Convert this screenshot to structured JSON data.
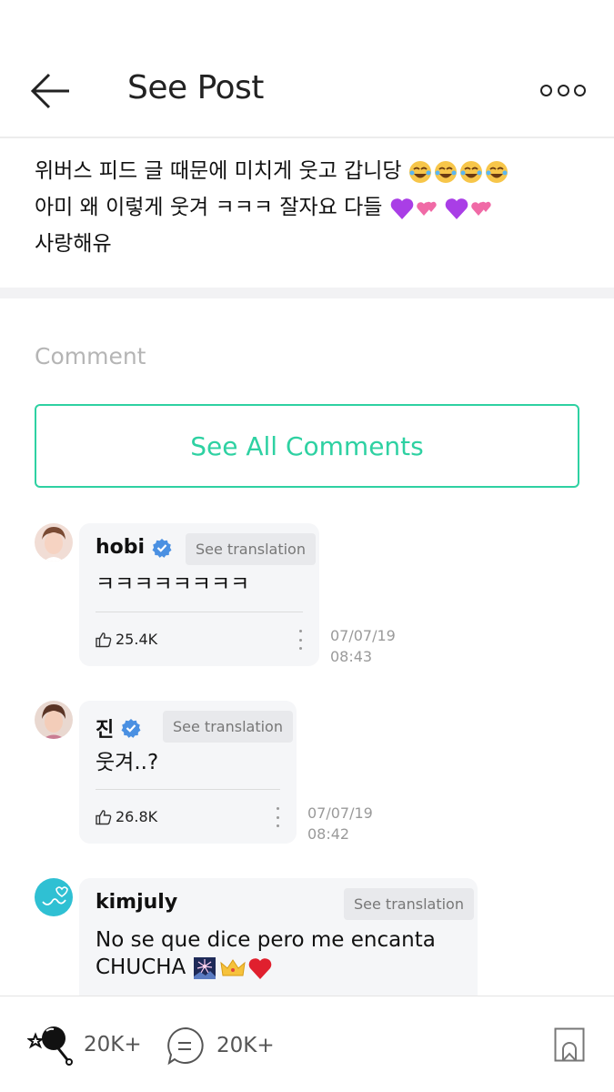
{
  "header": {
    "title": "See Post"
  },
  "post": {
    "line1": "위버스 피드 글 때문에 미치게 웃고 갑니당",
    "line2": "아미 왜 이렇게 웃겨 ㅋㅋㅋ 잘자요 다들",
    "line3": "사랑해유"
  },
  "comments_section": {
    "label": "Comment",
    "see_all_label": "See All Comments"
  },
  "comments": [
    {
      "author": "hobi",
      "verified": true,
      "translate_label": "See translation",
      "text": "ㅋㅋㅋㅋㅋㅋㅋㅋ",
      "likes": "25.4K",
      "date": "07/07/19",
      "time": "08:43"
    },
    {
      "author": "진",
      "verified": true,
      "translate_label": "See translation",
      "text": "웃겨..?",
      "likes": "26.8K",
      "date": "07/07/19",
      "time": "08:42"
    },
    {
      "author": "kimjuly",
      "verified": false,
      "translate_label": "See translation",
      "text_line1": "No se que dice pero me encanta",
      "text_line2": "CHUCHA"
    }
  ],
  "bottom_bar": {
    "cheers_count": "20K+",
    "comments_count": "20K+"
  },
  "colors": {
    "accent": "#2ed1a2",
    "verified_blue": "#4a90e2",
    "bubble_bg": "#f5f6f8"
  },
  "icons": [
    "back-arrow-icon",
    "more-dots-icon",
    "verified-icon",
    "like-icon",
    "kebab-icon",
    "cheer-icon",
    "comment-icon",
    "bookmark-icon"
  ]
}
